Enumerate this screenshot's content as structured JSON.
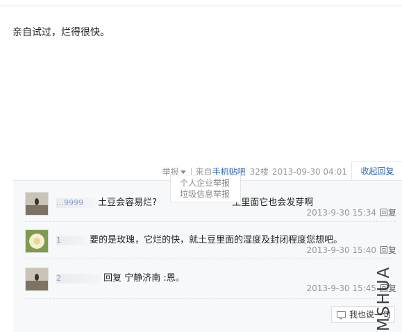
{
  "post": {
    "content": "亲自试过，烂得很快。",
    "report_label": "举报",
    "source_prefix": "来自",
    "source_link": "手机贴吧",
    "floor": "32楼",
    "time": "2013-09-30 04:01",
    "collapse_label": "收起回复"
  },
  "report_menu": [
    "个人企业举报",
    "垃圾信息举报"
  ],
  "replies": [
    {
      "username": "…9999",
      "text_before": "土豆会容易烂?",
      "text_after": "土里面它也会发芽啊",
      "time": "2013-9-30 15:34",
      "reply_label": "回复"
    },
    {
      "username": "1",
      "text": "要的是玫瑰，它烂的快，就土豆里面的湿度及封闭程度您想吧。",
      "time": "2013-9-30 15:40",
      "reply_label": "回复"
    },
    {
      "username": "2",
      "text": "回复 宁静济南 :恩。",
      "time": "2013-9-30 15:45",
      "reply_label": "回复"
    }
  ],
  "say_button": "我也说一句",
  "watermark": "MSHUA"
}
